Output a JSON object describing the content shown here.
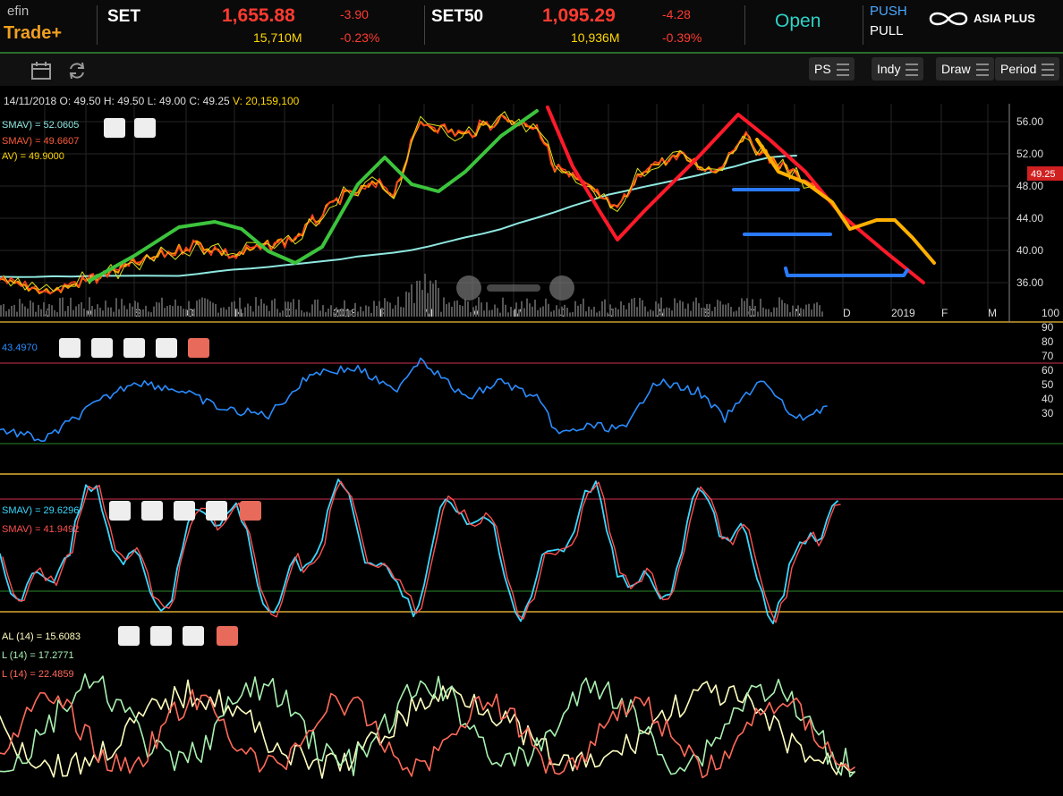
{
  "header": {
    "logo_top": "efin",
    "logo_bottom": "Trade+",
    "set": {
      "name": "SET",
      "value": "1,655.88",
      "change": "-3.90",
      "volume": "15,710M",
      "pct": "-0.23%"
    },
    "set50": {
      "name": "SET50",
      "value": "1,095.29",
      "change": "-4.28",
      "volume": "10,936M",
      "pct": "-0.39%"
    },
    "market_status": "Open",
    "push": "PUSH",
    "pull": "PULL",
    "brand": "ASIA PLUS"
  },
  "toolbar": {
    "buttons": [
      "PS",
      "Indy",
      "Draw",
      "Period"
    ]
  },
  "price_panel": {
    "date": "14/11/2018",
    "o": "O: 49.50",
    "h": "H: 49.50",
    "l": "L: 49.00",
    "c": "C: 49.25",
    "v": "V: 20,159,100",
    "legend": [
      "SMAV) = 52.0605",
      "SMAV) = 49.6607",
      "AV) = 49.9000"
    ],
    "y_ticks": [
      "56.00",
      "52.00",
      "48.00",
      "44.00",
      "40.00",
      "36.00"
    ],
    "last_price": "49.25",
    "months": [
      "J",
      "A",
      "S",
      "O",
      "N",
      "D",
      "2018",
      "F",
      "M",
      "A",
      "M",
      "J",
      "J",
      "A",
      "S",
      "O",
      "N",
      "D",
      "2019",
      "F",
      "M"
    ]
  },
  "rsi_panel": {
    "value_label": "43.4970",
    "y_ticks": [
      "100",
      "90",
      "80",
      "70",
      "60",
      "50",
      "40",
      "30"
    ]
  },
  "stoch_panel": {
    "legend": [
      "SMAV) = 29.6296",
      "SMAV) = 41.9492"
    ]
  },
  "dmi_panel": {
    "legend": [
      "AL (14) = 15.6083",
      "L (14) = 17.2771",
      "L (14) = 22.4859"
    ]
  },
  "colors": {
    "price_line": "#ff4020",
    "sma_long": "#8fe8e0",
    "sma_mid": "#ff9900",
    "green_draw": "#3cc43c",
    "red_draw": "#ff1a2a",
    "yellow_draw": "#ffb000",
    "blue_draw": "#2a7aff",
    "rsi": "#2a8cff",
    "stoch_k": "#3ad8ff",
    "stoch_d": "#ff5050",
    "dmi_adx": "#ffffc0",
    "dmi_plus": "#a8f0b0",
    "dmi_minus": "#ff6a5a"
  }
}
